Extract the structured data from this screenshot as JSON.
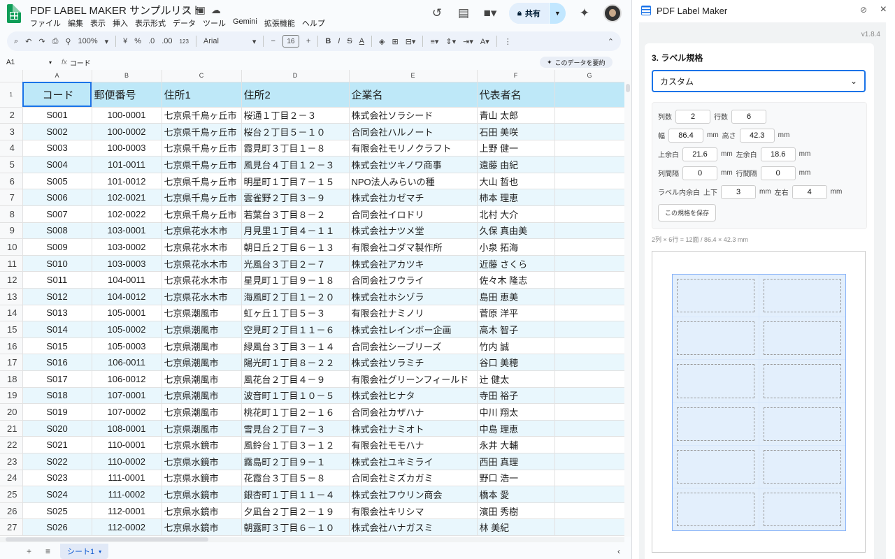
{
  "app": {
    "title": "PDF LABEL MAKER サンプルリスト",
    "menu": [
      "ファイル",
      "編集",
      "表示",
      "挿入",
      "表示形式",
      "データ",
      "ツール",
      "Gemini",
      "拡張機能",
      "ヘルプ"
    ],
    "share_label": "共有"
  },
  "toolbar": {
    "zoom": "100%",
    "currency": "¥",
    "percent": "%",
    "dec_down": ".0",
    "dec_up": ".00",
    "num_fmt": "123",
    "font": "Arial",
    "font_size": "16",
    "bold": "B",
    "italic": "I",
    "strike": "S",
    "text_color": "A"
  },
  "formula": {
    "cell": "A1",
    "content": "コード",
    "summarize": "このデータを要約"
  },
  "grid": {
    "col_letters": [
      "A",
      "B",
      "C",
      "D",
      "E",
      "F",
      "G"
    ],
    "headers": [
      "コード",
      "郵便番号",
      "住所1",
      "住所2",
      "企業名",
      "代表者名"
    ],
    "rows": [
      [
        "S001",
        "100-0001",
        "七京県千鳥ヶ丘市",
        "桜通１丁目２－３",
        "株式会社ソラシード",
        "青山 太郎"
      ],
      [
        "S002",
        "100-0002",
        "七京県千鳥ヶ丘市",
        "桜台２丁目５－１０",
        "合同会社ハルノート",
        "石田 美咲"
      ],
      [
        "S003",
        "100-0003",
        "七京県千鳥ヶ丘市",
        "霞見町３丁目１－８",
        "有限会社モリノクラフト",
        "上野 健一"
      ],
      [
        "S004",
        "101-0011",
        "七京県千鳥ヶ丘市",
        "風見台４丁目１２－３",
        "株式会社ツキノワ商事",
        "遠藤 由紀"
      ],
      [
        "S005",
        "101-0012",
        "七京県千鳥ヶ丘市",
        "明星町１丁目７－１５",
        "NPO法人みらいの種",
        "大山 哲也"
      ],
      [
        "S006",
        "102-0021",
        "七京県千鳥ヶ丘市",
        "雲雀野２丁目３－９",
        "株式会社カゼマチ",
        "柿本 理恵"
      ],
      [
        "S007",
        "102-0022",
        "七京県千鳥ヶ丘市",
        "若葉台３丁目８－２",
        "合同会社イロドリ",
        "北村 大介"
      ],
      [
        "S008",
        "103-0001",
        "七京県花水木市",
        "月見里１丁目４－１１",
        "株式会社ナツメ堂",
        "久保 真由美"
      ],
      [
        "S009",
        "103-0002",
        "七京県花水木市",
        "朝日丘２丁目６－１３",
        "有限会社コダマ製作所",
        "小泉 拓海"
      ],
      [
        "S010",
        "103-0003",
        "七京県花水木市",
        "光風台３丁目２－７",
        "株式会社アカツキ",
        "近藤 さくら"
      ],
      [
        "S011",
        "104-0011",
        "七京県花水木市",
        "星見町１丁目９－１８",
        "合同会社フウライ",
        "佐々木 隆志"
      ],
      [
        "S012",
        "104-0012",
        "七京県花水木市",
        "海風町２丁目１－２０",
        "株式会社ホシゾラ",
        "島田 恵美"
      ],
      [
        "S013",
        "105-0001",
        "七京県潮風市",
        "虹ヶ丘１丁目５－３",
        "有限会社ナミノリ",
        "菅原 洋平"
      ],
      [
        "S014",
        "105-0002",
        "七京県潮風市",
        "空見町２丁目１１－６",
        "株式会社レインボー企画",
        "高木 智子"
      ],
      [
        "S015",
        "105-0003",
        "七京県潮風市",
        "緑風台３丁目３－１４",
        "合同会社シーブリーズ",
        "竹内 誠"
      ],
      [
        "S016",
        "106-0011",
        "七京県潮風市",
        "陽光町１丁目８－２２",
        "株式会社ソラミチ",
        "谷口 美穂"
      ],
      [
        "S017",
        "106-0012",
        "七京県潮風市",
        "風花台２丁目４－９",
        "有限会社グリーンフィールド",
        "辻 健太"
      ],
      [
        "S018",
        "107-0001",
        "七京県潮風市",
        "波音町１丁目１０－５",
        "株式会社ヒナタ",
        "寺田 裕子"
      ],
      [
        "S019",
        "107-0002",
        "七京県潮風市",
        "桃花町１丁目２－１６",
        "合同会社カザハナ",
        "中川 翔太"
      ],
      [
        "S020",
        "108-0001",
        "七京県潮風市",
        "雪見台２丁目７－３",
        "株式会社ナミオト",
        "中島 理恵"
      ],
      [
        "S021",
        "110-0001",
        "七京県水鏡市",
        "風鈴台１丁目３－１２",
        "有限会社モモハナ",
        "永井 大輔"
      ],
      [
        "S022",
        "110-0002",
        "七京県水鏡市",
        "霧島町２丁目９－１",
        "株式会社ユキミライ",
        "西田 真理"
      ],
      [
        "S023",
        "111-0001",
        "七京県水鏡市",
        "花霞台３丁目５－８",
        "合同会社ミズカガミ",
        "野口 浩一"
      ],
      [
        "S024",
        "111-0002",
        "七京県水鏡市",
        "銀杏町１丁目１１－４",
        "株式会社フウリン商会",
        "橋本 愛"
      ],
      [
        "S025",
        "112-0001",
        "七京県水鏡市",
        "夕凪台２丁目２－１９",
        "有限会社キリシマ",
        "濱田 秀樹"
      ],
      [
        "S026",
        "112-0002",
        "七京県水鏡市",
        "朝露町３丁目６－１０",
        "株式会社ハナガスミ",
        "林 美紀"
      ]
    ]
  },
  "sheet_tab": "シート1",
  "panel": {
    "title": "PDF Label Maker",
    "version": "v1.8.4",
    "section": "3. ラベル規格",
    "select_value": "カスタム",
    "labels": {
      "cols": "列数",
      "rows": "行数",
      "width": "幅",
      "height": "高さ",
      "top": "上余白",
      "left": "左余白",
      "colgap": "列間隔",
      "rowgap": "行間隔",
      "padding": "ラベル内余白",
      "pad_v": "上下",
      "pad_h": "左右",
      "mm": "mm"
    },
    "values": {
      "cols": "2",
      "rows": "6",
      "width": "86.4",
      "height": "42.3",
      "top": "21.6",
      "left": "18.6",
      "colgap": "0",
      "rowgap": "0",
      "pad_v": "3",
      "pad_h": "4"
    },
    "save_button": "この規格を保存",
    "summary": "2列 × 6行 = 12面 / 86.4 × 42.3 mm",
    "preview_cols": 2,
    "preview_rows": 6
  },
  "colors": {
    "accent": "#1a73e8",
    "header_fill": "#bee8f8",
    "stripe": "#e9f7fd",
    "share": "#c2e7ff"
  }
}
